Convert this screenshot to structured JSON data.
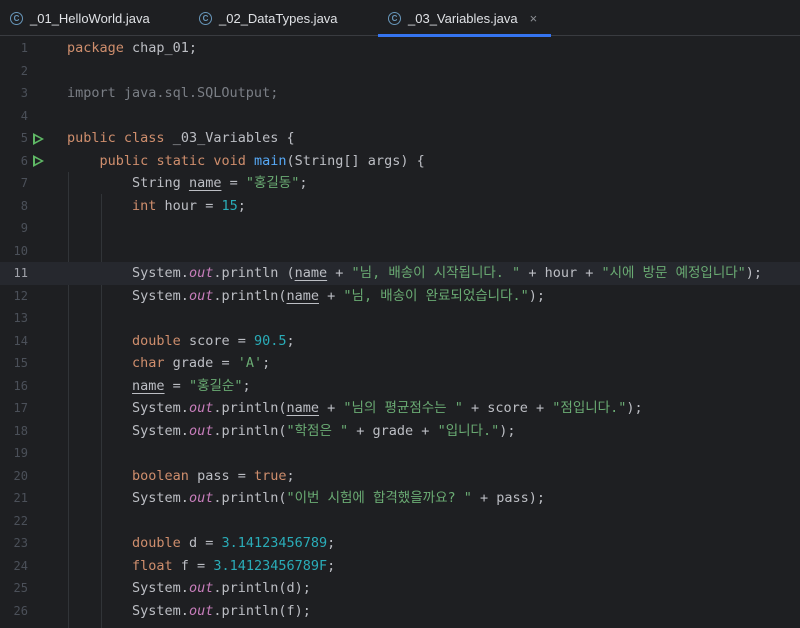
{
  "tabs": [
    {
      "label": "_01_HelloWorld.java",
      "active": false
    },
    {
      "label": "_02_DataTypes.java",
      "active": false
    },
    {
      "label": "_03_Variables.java",
      "active": true
    }
  ],
  "tab_icon_letter": "C",
  "close_icon": "×",
  "line_numbers": [
    "1",
    "2",
    "3",
    "4",
    "5",
    "6",
    "7",
    "8",
    "9",
    "10",
    "11",
    "12",
    "13",
    "14",
    "15",
    "16",
    "17",
    "18",
    "19",
    "20",
    "21",
    "22",
    "23",
    "24",
    "25",
    "26"
  ],
  "current_line": "11",
  "code": {
    "package_kw": "package",
    "package_name": " chap_01;",
    "import_line": "import java.sql.SQLOutput;",
    "public_kw": "public",
    "class_kw": "class",
    "class_name": " _03_Variables {",
    "static_kw": "static",
    "void_kw": "void",
    "main_fn": "main",
    "main_args": "(String[] args) {",
    "string_type": "String ",
    "var_name": "name",
    "assign": " = ",
    "str_hong_gildong": "\"홍길동\"",
    "semicolon": ";",
    "int_kw": "int",
    "hour_decl": " hour = ",
    "num_15": "15",
    "system_prefix": "System.",
    "out": "out",
    "println_open": ".println(",
    "println_open_space": ".println (",
    "plus": " + ",
    "str_l11_a": "\"님, 배송이 시작됩니다. \"",
    "hour_var": "hour",
    "str_l11_b": "\"시에 방문 예정입니다\"",
    "close_paren_semicolon": ");",
    "str_l12": "\"님, 배송이 완료되었습니다.\"",
    "double_kw": "double",
    "score_decl": " score = ",
    "num_905": "90.5",
    "char_kw": "char",
    "grade_decl": " grade = ",
    "char_A": "'A'",
    "str_hong_gilsun": "\"홍길순\"",
    "str_l17_a": "\"님의 평균점수는 \"",
    "score_var": "score",
    "str_l17_b": "\"점입니다.\"",
    "str_l18_a": "\"학점은 \"",
    "grade_var": "grade",
    "str_l18_b": "\"입니다.\"",
    "boolean_kw": "boolean",
    "pass_decl": " pass = ",
    "true_kw": "true",
    "str_l21": "\"이번 시험에 합격했을까요? \"",
    "pass_var": "pass",
    "d_decl": " d = ",
    "num_pi": "3.14123456789",
    "float_kw": "float",
    "f_decl": " f = ",
    "num_pi_f": "3.14123456789F",
    "print_d": "d",
    "print_f": "f"
  },
  "colors": {
    "background": "#1e1f22",
    "keyword": "#cf8e6d",
    "string": "#6aab73",
    "number": "#2aacb8",
    "function": "#56a8f5",
    "static_field": "#c77dbb",
    "text": "#bcbec4",
    "tab_indicator": "#3574f0",
    "run_icon": "#5fb865"
  }
}
